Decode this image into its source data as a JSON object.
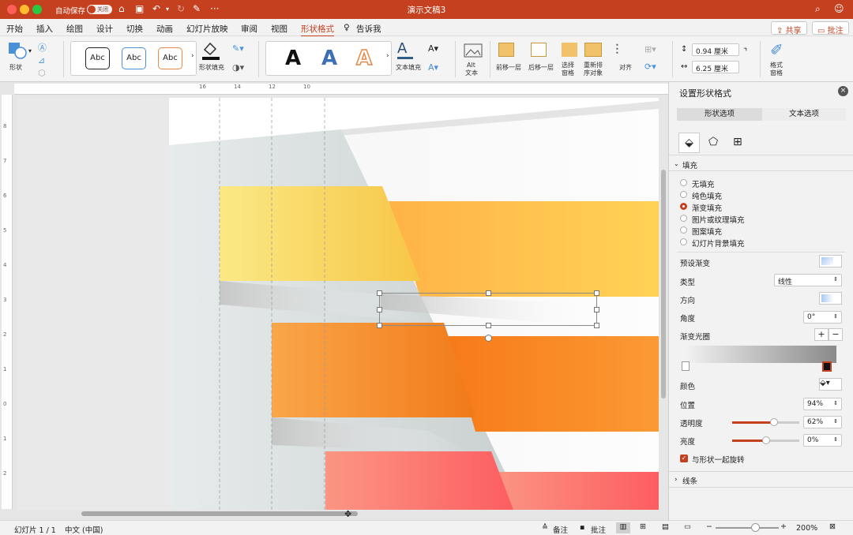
{
  "titlebar": {
    "autosave_label": "自动保存",
    "toggle_label": "关闭",
    "doc_title": "演示文稿3"
  },
  "tabs": [
    {
      "label": "开始"
    },
    {
      "label": "插入"
    },
    {
      "label": "绘图"
    },
    {
      "label": "设计"
    },
    {
      "label": "切换"
    },
    {
      "label": "动画"
    },
    {
      "label": "幻灯片放映"
    },
    {
      "label": "审阅"
    },
    {
      "label": "视图"
    },
    {
      "label": "形状格式"
    },
    {
      "label": "告诉我"
    }
  ],
  "top_buttons": {
    "share": "共享",
    "comments": "批注"
  },
  "ribbon": {
    "shape_label": "形状",
    "style_abc": "Abc",
    "shape_fill_label": "形状填充",
    "wordart_letter": "A",
    "text_fill_label": "文本填充",
    "alt_text_label1": "Alt",
    "alt_text_label2": "文本",
    "forward_label": "前移一层",
    "backward_label": "后移一层",
    "select_pane1": "选择",
    "select_pane2": "窗格",
    "reorder1": "重新排",
    "reorder2": "序对象",
    "align_label": "对齐",
    "height_value": "0.94 厘米",
    "width_value": "6.25 厘米",
    "format_pane1": "格式",
    "format_pane2": "窗格",
    "colors": {
      "accent": "#c4401f"
    }
  },
  "ruler": {
    "h_ticks": [
      "16",
      "14",
      "12",
      "10"
    ],
    "v_ticks": [
      "8",
      "7",
      "6",
      "5",
      "4",
      "3",
      "2",
      "1",
      "0",
      "1",
      "2"
    ]
  },
  "pane": {
    "title": "设置形状格式",
    "tab_shape": "形状选项",
    "tab_text": "文本选项",
    "fill_section": "填充",
    "fill_options": [
      "无填充",
      "纯色填充",
      "渐变填充",
      "图片或纹理填充",
      "图案填充",
      "幻灯片背景填充"
    ],
    "selected_fill": "渐变填充",
    "preset_label": "预设渐变",
    "type_label": "类型",
    "type_value": "线性",
    "direction_label": "方向",
    "angle_label": "角度",
    "angle_value": "0°",
    "stops_label": "渐变光圈",
    "color_label": "颜色",
    "position_label": "位置",
    "position_value": "94%",
    "transparency_label": "透明度",
    "transparency_value": "62%",
    "brightness_label": "亮度",
    "brightness_value": "0%",
    "rotate_label": "与形状一起旋转",
    "line_section": "线条"
  },
  "status": {
    "slide_info": "幻灯片 1 / 1",
    "language": "中文 (中国)",
    "notes": "备注",
    "comments": "批注",
    "zoom": "200%"
  }
}
